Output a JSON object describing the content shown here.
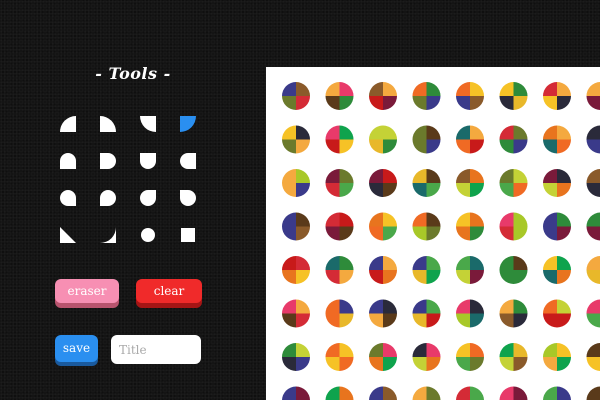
{
  "tools": {
    "title": "- Tools -",
    "shapes": [
      "quarter-tl",
      "quarter-tr",
      "quarter-bl",
      "quarter-tr-blue",
      "half-top",
      "half-right",
      "half-bottom",
      "half-left",
      "leaf-a",
      "leaf-b",
      "leaf-c",
      "leaf-d",
      "leaf-e",
      "leaf-f",
      "circle",
      "square"
    ]
  },
  "buttons": {
    "eraser": "eraser",
    "clear": "clear",
    "save": "save"
  },
  "title_input": {
    "placeholder": "Title",
    "value": ""
  },
  "colors": {
    "background": "#141414",
    "canvas": "#ffffff",
    "tool_fill": "#ffffff",
    "tool_selected": "#2a8ff0",
    "eraser": "#f78fb3",
    "clear": "#f02a2a",
    "save": "#2a8ff0"
  },
  "canvas": {
    "palette": [
      "#e8741e",
      "#2e8b3a",
      "#d42b36",
      "#f6c226",
      "#6b7a2c",
      "#7a1a3a",
      "#0fa34d",
      "#c4d236",
      "#f4a93f",
      "#3a3a8a",
      "#e83a6a",
      "#8a5a2a",
      "#1a6a6a",
      "#f06a24",
      "#4aa84a",
      "#c81a1a",
      "#a8c828",
      "#5a3a1a",
      "#e8b82a",
      "#2a2a3a"
    ]
  }
}
